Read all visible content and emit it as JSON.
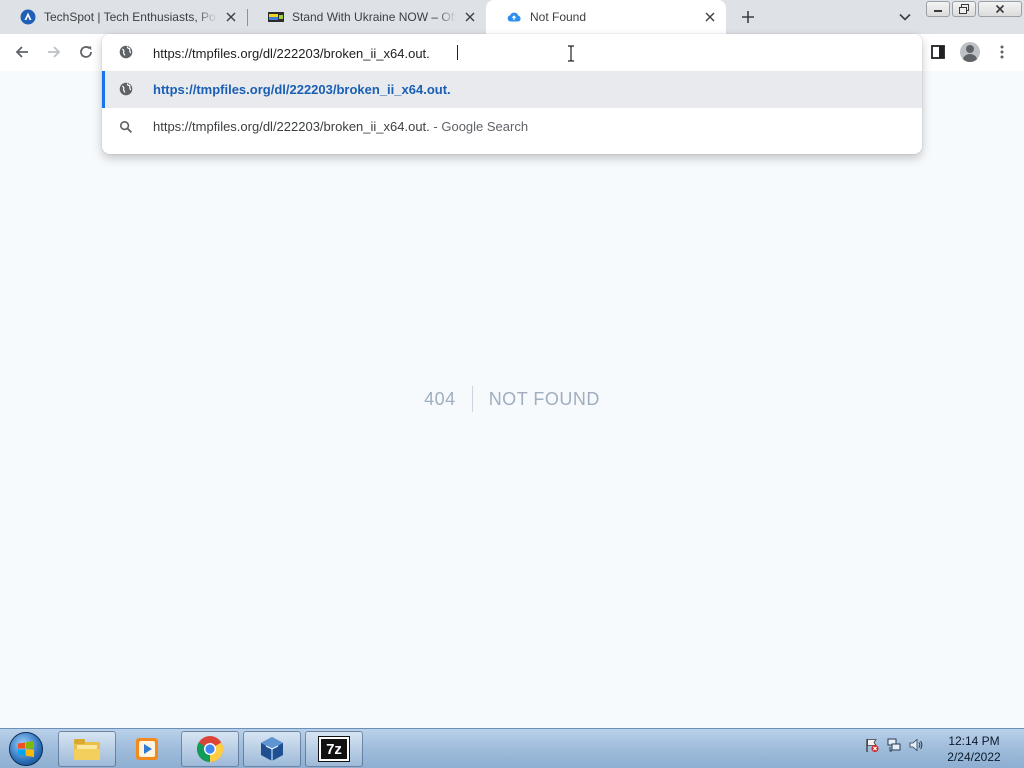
{
  "tabs": [
    {
      "title": "TechSpot | Tech Enthusiasts, Power Users",
      "favicon": "techspot-icon"
    },
    {
      "title": "Stand With Ukraine NOW – Official",
      "favicon": "ukraine-banner-icon"
    },
    {
      "title": "Not Found",
      "favicon": "cloud-upload-icon"
    }
  ],
  "omnibox": {
    "value": "https://tmpfiles.org/dl/222203/broken_ii_x64.out.",
    "suggestions": [
      {
        "text": "https://tmpfiles.org/dl/222203/broken_ii_x64.out.",
        "icon": "globe-icon"
      },
      {
        "text": "https://tmpfiles.org/dl/222203/broken_ii_x64.out.",
        "separator": " - ",
        "suffix": "Google Search",
        "icon": "search-icon"
      }
    ]
  },
  "page": {
    "code": "404",
    "message": "NOT FOUND"
  },
  "taskbar": {
    "apps": [
      "file-explorer-icon",
      "media-player-icon",
      "chrome-icon",
      "virtualbox-icon",
      "7zip-icon"
    ],
    "zip_label": "7z",
    "clock_time": "12:14 PM",
    "clock_date": "2/24/2022"
  },
  "colors": {
    "accent": "#1a73e8",
    "page_background": "#f7fafc",
    "not_found_text": "#a0aec0"
  }
}
